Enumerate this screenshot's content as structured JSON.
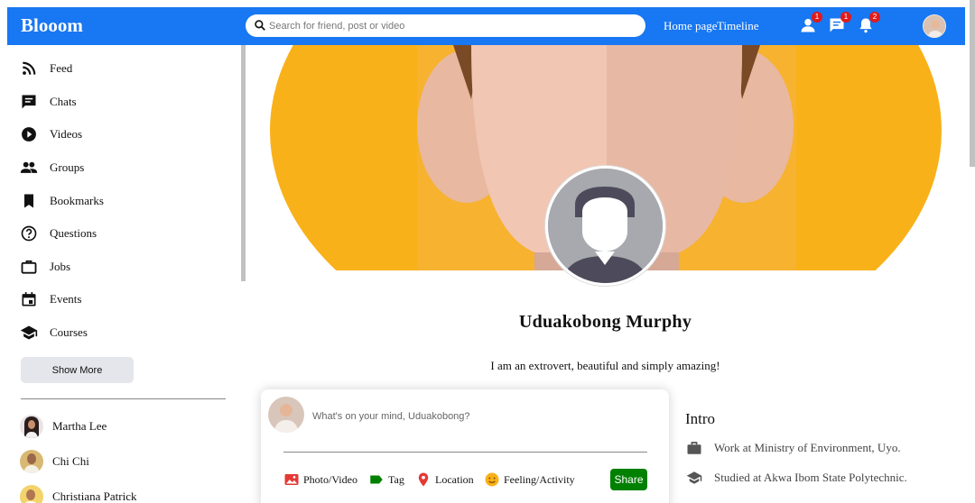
{
  "app": {
    "brand": "Blooom"
  },
  "search": {
    "placeholder": "Search for friend, post or video"
  },
  "topnav": {
    "links": [
      "Home page",
      "Timeline"
    ],
    "icons": [
      {
        "name": "person-icon",
        "badge": "1"
      },
      {
        "name": "chat-icon",
        "badge": "1"
      },
      {
        "name": "notification-icon",
        "badge": "2"
      }
    ]
  },
  "sidebar": {
    "items": [
      {
        "label": "Feed",
        "icon": "rss-feed-icon"
      },
      {
        "label": "Chats",
        "icon": "chat-icon"
      },
      {
        "label": "Videos",
        "icon": "play-circle-icon"
      },
      {
        "label": "Groups",
        "icon": "group-icon"
      },
      {
        "label": "Bookmarks",
        "icon": "bookmark-icon"
      },
      {
        "label": "Questions",
        "icon": "help-circle-icon"
      },
      {
        "label": "Jobs",
        "icon": "work-icon"
      },
      {
        "label": "Events",
        "icon": "event-icon"
      },
      {
        "label": "Courses",
        "icon": "school-icon"
      }
    ],
    "show_more": "Show More",
    "friends": [
      "Martha Lee",
      "Chi Chi",
      "Christiana Patrick"
    ]
  },
  "profile": {
    "name": "Uduakobong Murphy",
    "bio": "I am an extrovert, beautiful and simply amazing!"
  },
  "share": {
    "placeholder": "What's on your mind, Uduakobong?",
    "options": [
      {
        "label": "Photo/Video",
        "icon": "photo-icon",
        "color": "#e53935"
      },
      {
        "label": "Tag",
        "icon": "label-icon",
        "color": "#008000"
      },
      {
        "label": "Location",
        "icon": "location-pin-icon",
        "color": "#e53935"
      },
      {
        "label": "Feeling/Activity",
        "icon": "emoji-icon",
        "color": "#f9b11a"
      }
    ],
    "button": "Share"
  },
  "intro": {
    "title": "Intro",
    "items": [
      {
        "text": "Work at Ministry of Environment, Uyo.",
        "icon": "briefcase-icon"
      },
      {
        "text": "Studied at Akwa Ibom State Polytechnic.",
        "icon": "school-icon"
      }
    ]
  },
  "colors": {
    "accent": "#1877f2",
    "badge": "#e01b1b",
    "share_button": "#008000",
    "cover_bg": "#f9b11a"
  }
}
